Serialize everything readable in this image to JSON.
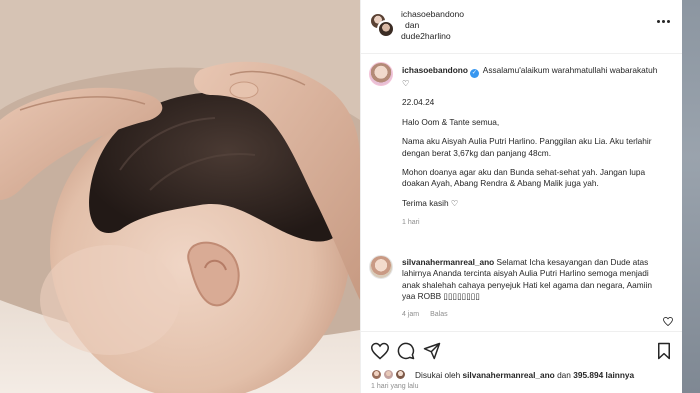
{
  "post": {
    "header": {
      "user1": "ichasoebandono",
      "conjunction": "dan",
      "user2": "dude2harlino"
    },
    "caption": {
      "username": "ichasoebandono",
      "lines": [
        "Assalamu'alaikum warahmatullahi wabarakatuh ♡",
        "22.04.24",
        "Halo Oom & Tante semua,",
        "Nama aku Aisyah Aulia Putri Harlino. Panggilan aku Lia. Aku terlahir dengan berat 3,67kg dan panjang 48cm.",
        "Mohon doanya agar aku dan Bunda sehat-sehat yah. Jangan lupa doakan Ayah, Abang Rendra & Abang Malik juga yah.",
        "Terima kasih ♡"
      ],
      "time": "1 hari"
    },
    "comment": {
      "username": "silvanahermanreal_ano",
      "text": "Selamat Icha kesayangan dan Dude atas lahirnya Ananda tercinta aisyah Aulia Putri Harlino semoga menjadi anak shalehah cahaya penyejuk Hati kel agama dan negara, Aamiin yaa ROBB ▯▯▯▯▯▯▯▯",
      "time": "4 jam",
      "reply_label": "Balas"
    },
    "likes": {
      "prefix": "Disukai oleh",
      "user": "silvanahermanreal_ano",
      "middle": "dan",
      "count": "395.894",
      "suffix": "lainnya"
    },
    "post_time": "1 hari yang lalu",
    "icons": [
      "heart-icon",
      "comment-icon",
      "share-icon",
      "bookmark-icon",
      "more-icon",
      "verified-icon"
    ]
  }
}
